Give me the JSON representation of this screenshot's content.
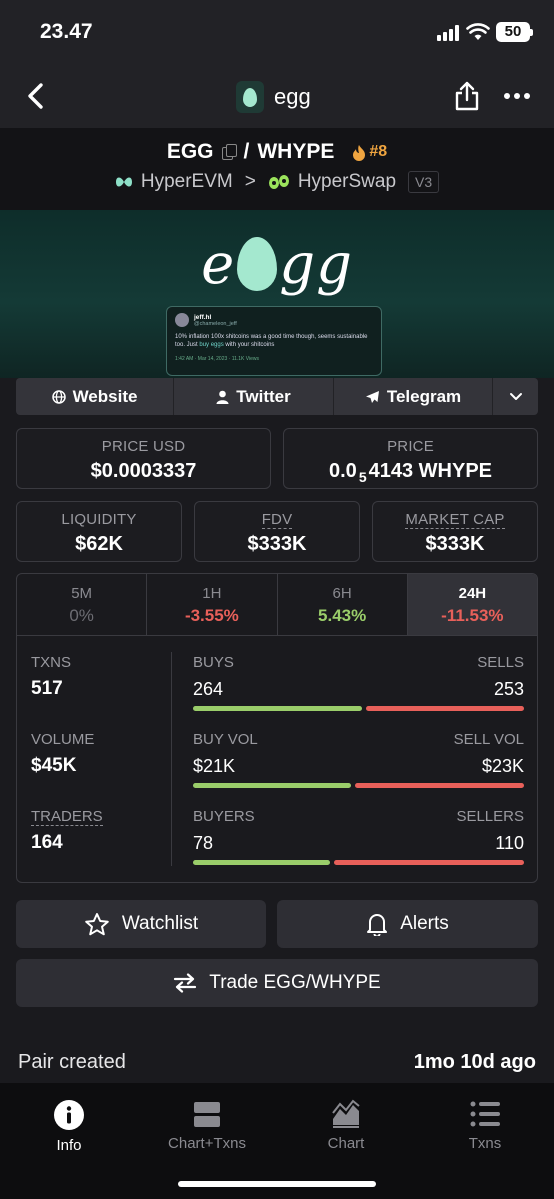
{
  "status": {
    "time": "23.47",
    "battery": "50"
  },
  "header": {
    "title": "egg"
  },
  "pair": {
    "base": "EGG",
    "separator": "/",
    "quote": "WHYPE",
    "rank": "#8",
    "chain": "HyperEVM",
    "chevron": ">",
    "dex": "HyperSwap",
    "version": "V3"
  },
  "banner": {
    "logo_left": "e",
    "logo_right": "gg",
    "tweet": {
      "name": "jeff.hl",
      "handle": "@chameleon_jeff",
      "body_pre": "10% inflation 100x shitcoins was a good time though, seems sustainable too. Just ",
      "body_link": "buy eggs",
      "body_post": " with your shitcoins",
      "footer": "1:42 AM · Mar 14, 2023 · 11.1K Views"
    }
  },
  "links": {
    "website": "Website",
    "twitter": "Twitter",
    "telegram": "Telegram"
  },
  "price": {
    "usd_label": "PRICE USD",
    "usd_value": "$0.0003337",
    "native_label": "PRICE",
    "native_prefix": "0.0",
    "native_sub": "5",
    "native_rest": "4143 WHYPE"
  },
  "metrics": [
    {
      "label": "LIQUIDITY",
      "value": "$62K"
    },
    {
      "label": "FDV",
      "value": "$333K"
    },
    {
      "label": "MARKET CAP",
      "value": "$333K"
    }
  ],
  "timeframes": [
    {
      "label": "5M",
      "change": "0%"
    },
    {
      "label": "1H",
      "change": "-3.55%"
    },
    {
      "label": "6H",
      "change": "5.43%"
    },
    {
      "label": "24H",
      "change": "-11.53%"
    }
  ],
  "stats": {
    "txns_label": "TXNS",
    "txns": "517",
    "volume_label": "VOLUME",
    "volume": "$45K",
    "traders_label": "TRADERS",
    "traders": "164",
    "buys_label": "BUYS",
    "buys": "264",
    "sells_label": "SELLS",
    "sells": "253",
    "buy_vol_label": "BUY VOL",
    "buy_vol": "$21K",
    "sell_vol_label": "SELL VOL",
    "sell_vol": "$23K",
    "buyers_label": "BUYERS",
    "buyers": "78",
    "sellers_label": "SELLERS",
    "sellers": "110",
    "buys_ratio": 0.511,
    "buy_vol_ratio": 0.477,
    "buyers_ratio": 0.415
  },
  "actions": {
    "watchlist": "Watchlist",
    "alerts": "Alerts",
    "trade": "Trade EGG/WHYPE"
  },
  "pair_created": {
    "label": "Pair created",
    "value": "1mo 10d ago"
  },
  "nav": [
    {
      "label": "Info",
      "icon": "info-icon"
    },
    {
      "label": "Chart+Txns",
      "icon": "split-view-icon"
    },
    {
      "label": "Chart",
      "icon": "area-chart-icon"
    },
    {
      "label": "Txns",
      "icon": "list-icon"
    }
  ],
  "colors": {
    "positive": "#9acd6a",
    "negative": "#e8605a",
    "accent_egg": "#a4e8cf",
    "rank": "#f0a540"
  }
}
